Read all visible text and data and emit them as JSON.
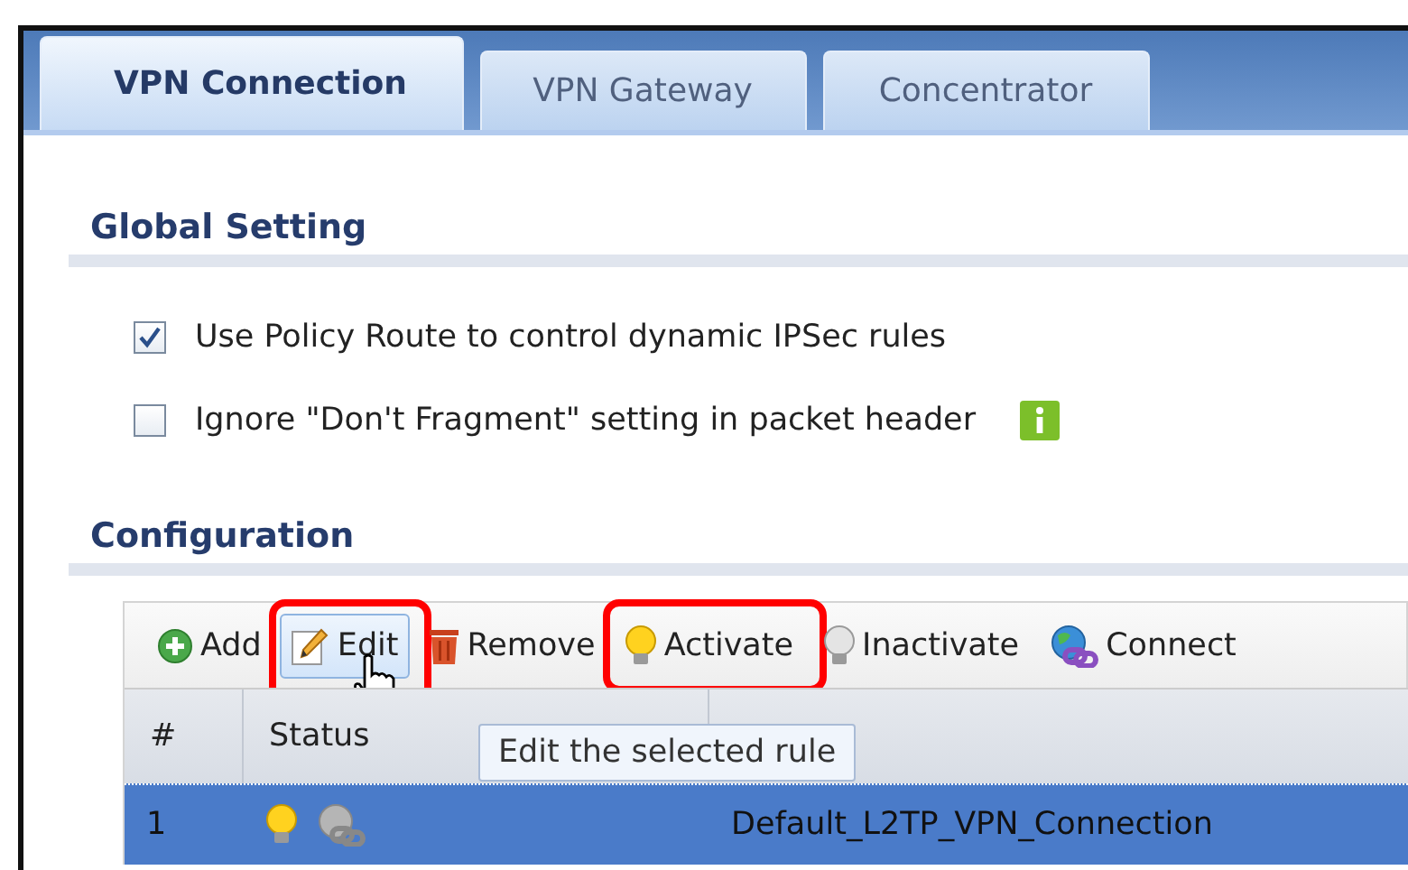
{
  "tabs": [
    {
      "label": "VPN Connection",
      "selected": true
    },
    {
      "label": "VPN Gateway",
      "selected": false
    },
    {
      "label": "Concentrator",
      "selected": false
    }
  ],
  "global_setting": {
    "title": "Global Setting",
    "options": [
      {
        "label": "Use Policy Route to control dynamic IPSec rules",
        "checked": true,
        "info": false
      },
      {
        "label": "Ignore \"Don't Fragment\" setting in packet header",
        "checked": false,
        "info": true
      }
    ]
  },
  "configuration": {
    "title": "Configuration",
    "toolbar": [
      {
        "kind": "add",
        "label": "Add",
        "hovered": false,
        "highlighted": false
      },
      {
        "kind": "edit",
        "label": "Edit",
        "hovered": true,
        "highlighted": true
      },
      {
        "kind": "remove",
        "label": "Remove",
        "hovered": false,
        "highlighted": false
      },
      {
        "kind": "activate",
        "label": "Activate",
        "hovered": false,
        "highlighted": true
      },
      {
        "kind": "inactivate",
        "label": "Inactivate",
        "hovered": false,
        "highlighted": false
      },
      {
        "kind": "connect",
        "label": "Connect",
        "hovered": false,
        "highlighted": false
      }
    ],
    "tooltip": "Edit the selected rule",
    "table": {
      "columns": [
        {
          "label": "#"
        },
        {
          "label": "Status"
        }
      ],
      "rows": [
        {
          "number": "1",
          "active": true,
          "connected": false,
          "name": "Default_L2TP_VPN_Connection",
          "selected": true
        }
      ]
    }
  }
}
